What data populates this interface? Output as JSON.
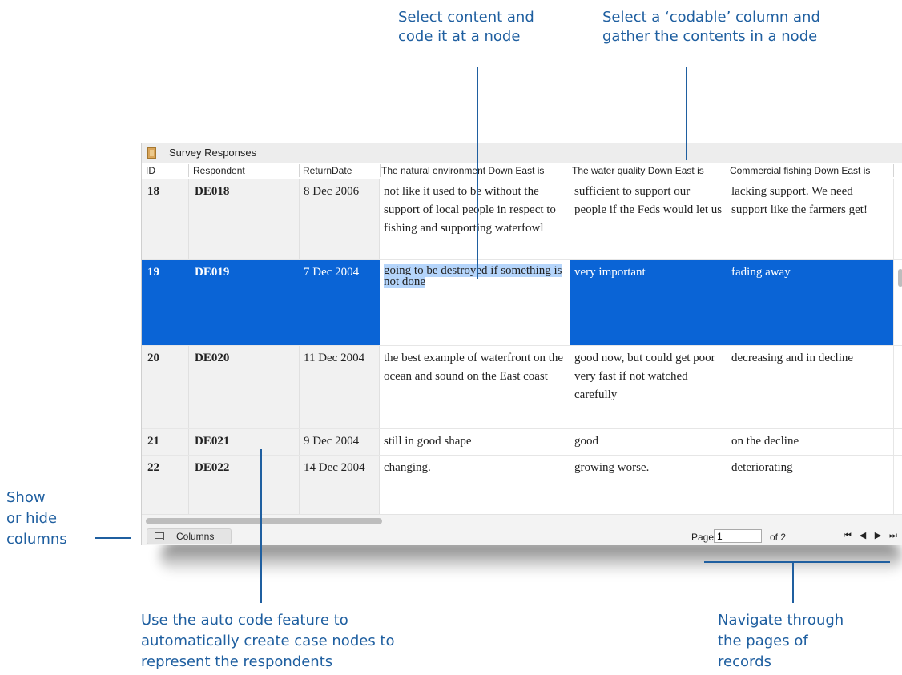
{
  "callouts": {
    "select_content": [
      "Select content and",
      "code it at a node"
    ],
    "codable_column": [
      "Select a ‘codable’ column and",
      "gather the contents in a node"
    ],
    "show_hide": [
      "Show",
      "or hide",
      "columns"
    ],
    "auto_code": [
      "Use the auto code feature to",
      "automatically create case nodes to",
      "represent the respondents"
    ],
    "navigate": [
      "Navigate through",
      "the pages of",
      "records"
    ]
  },
  "window": {
    "title": "Survey Responses",
    "icon": "document-icon"
  },
  "table": {
    "headers": [
      "ID",
      "Respondent",
      "ReturnDate",
      "The natural environment Down East is",
      "The water quality Down East is",
      "Commercial fishing Down East is"
    ],
    "rows": [
      {
        "id": "18",
        "respondent": "DE018",
        "date": "8 Dec 2006",
        "env": "not like it used to be without the support of local people in respect to fishing and supporting waterfowl",
        "water": "sufficient to support our people if the Feds would let us",
        "fishing": "lacking support. We need support like the farmers get!"
      },
      {
        "id": "19",
        "respondent": "DE019",
        "date": "7 Dec 2004",
        "env": "going to be destroyed if something is not done",
        "water": "very important",
        "fishing": "fading away"
      },
      {
        "id": "20",
        "respondent": "DE020",
        "date": "11 Dec 2004",
        "env": "the best example of waterfront on the ocean and sound on the East coast",
        "water": "good now, but could get poor very fast if not watched carefully",
        "fishing": "decreasing and in decline"
      },
      {
        "id": "21",
        "respondent": "DE021",
        "date": "9 Dec 2004",
        "env": "still in good shape",
        "water": "good",
        "fishing": "on the decline"
      },
      {
        "id": "22",
        "respondent": "DE022",
        "date": "14 Dec 2004",
        "env": "changing.",
        "water": "growing worse.",
        "fishing": "deteriorating"
      }
    ]
  },
  "footer": {
    "columns_label": "Columns",
    "columns_icon": "table-icon",
    "page_label": "Page",
    "page_value": "1",
    "of_label": "of 2",
    "nav": {
      "first": "⏮",
      "prev": "◀",
      "next": "▶",
      "last": "⏭"
    }
  },
  "colors": {
    "callout": "#1f5fa0",
    "selection": "#0a64d6",
    "text_highlight": "#b5d5fb"
  }
}
